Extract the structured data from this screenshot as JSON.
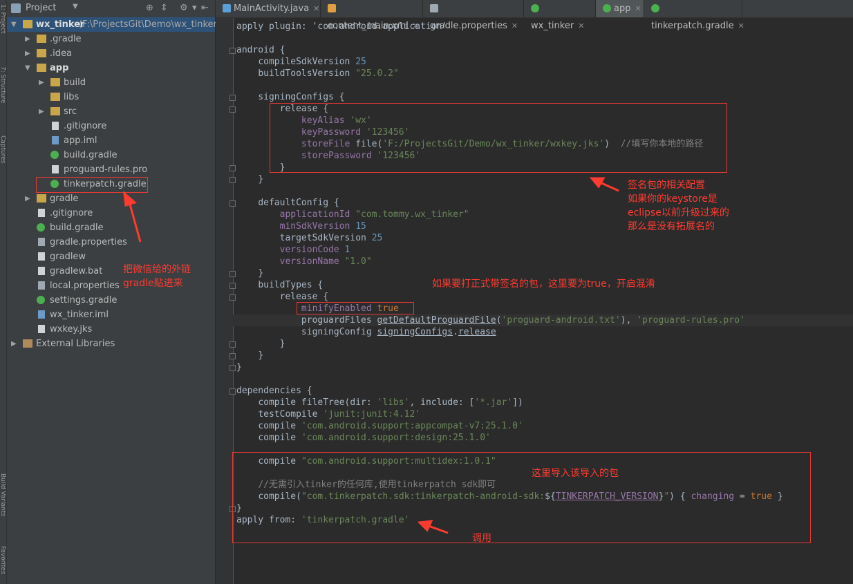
{
  "tool_strip": {
    "top_label": "1: Project",
    "mid_label": "7: Structure",
    "low_label": "Captures",
    "bottom_label": "Build Variants",
    "fav_label": "Favorites"
  },
  "project_panel": {
    "title": "Project",
    "tree": [
      {
        "label": "wx_tinker",
        "suffix": "(F:\\ProjectsGit\\Demo\\wx_tinker)",
        "depth": 0,
        "arrow": "open",
        "icon": "folder-icon"
      },
      {
        "label": ".gradle",
        "depth": 1,
        "arrow": "closed",
        "icon": "folder-icon"
      },
      {
        "label": ".idea",
        "depth": 1,
        "arrow": "closed",
        "icon": "folder-icon"
      },
      {
        "label": "app",
        "depth": 1,
        "arrow": "open",
        "icon": "folder-icon"
      },
      {
        "label": "build",
        "depth": 2,
        "arrow": "closed",
        "icon": "folder-icon"
      },
      {
        "label": "libs",
        "depth": 2,
        "arrow": "none",
        "icon": "folder-icon"
      },
      {
        "label": "src",
        "depth": 2,
        "arrow": "closed",
        "icon": "folder-icon"
      },
      {
        "label": ".gitignore",
        "depth": 2,
        "arrow": "none",
        "icon": "file-icon"
      },
      {
        "label": "app.iml",
        "depth": 2,
        "arrow": "none",
        "icon": "iml-icon"
      },
      {
        "label": "build.gradle",
        "depth": 2,
        "arrow": "none",
        "icon": "gradle-icon"
      },
      {
        "label": "proguard-rules.pro",
        "depth": 2,
        "arrow": "none",
        "icon": "file-icon"
      },
      {
        "label": "tinkerpatch.gradle",
        "depth": 2,
        "arrow": "none",
        "icon": "gradle-icon"
      },
      {
        "label": "gradle",
        "depth": 1,
        "arrow": "closed",
        "icon": "folder-icon"
      },
      {
        "label": ".gitignore",
        "depth": 1,
        "arrow": "none",
        "icon": "file-icon"
      },
      {
        "label": "build.gradle",
        "depth": 1,
        "arrow": "none",
        "icon": "gradle-icon"
      },
      {
        "label": "gradle.properties",
        "depth": 1,
        "arrow": "none",
        "icon": "properties-icon"
      },
      {
        "label": "gradlew",
        "depth": 1,
        "arrow": "none",
        "icon": "file-icon"
      },
      {
        "label": "gradlew.bat",
        "depth": 1,
        "arrow": "none",
        "icon": "file-icon"
      },
      {
        "label": "local.properties",
        "depth": 1,
        "arrow": "none",
        "icon": "properties-icon"
      },
      {
        "label": "settings.gradle",
        "depth": 1,
        "arrow": "none",
        "icon": "gradle-icon"
      },
      {
        "label": "wx_tinker.iml",
        "depth": 1,
        "arrow": "none",
        "icon": "iml-icon"
      },
      {
        "label": "wxkey.jks",
        "depth": 1,
        "arrow": "none",
        "icon": "file-icon"
      },
      {
        "label": "External Libraries",
        "depth": 0,
        "arrow": "closed",
        "icon": "library-icon"
      }
    ]
  },
  "tabs": [
    {
      "label": "MainActivity.java",
      "icon": "java-class-icon"
    },
    {
      "label": "content_main.xml",
      "icon": "xml-icon"
    },
    {
      "label": "gradle.properties",
      "icon": "properties-icon"
    },
    {
      "label": "wx_tinker",
      "icon": "gradle-icon"
    },
    {
      "label": "app",
      "icon": "gradle-icon",
      "active": true
    },
    {
      "label": "tinkerpatch.gradle",
      "icon": "gradle-icon"
    }
  ],
  "code_lines": [
    "apply plugin: 'com.android.application'",
    "android {",
    "compileSdkVersion 25",
    "buildToolsVersion \"25.0.2\"",
    "signingConfigs {",
    "release {",
    "keyAlias 'wx'",
    "keyPassword '123456'",
    "storeFile file('F:/ProjectsGit/Demo/wx_tinker/wxkey.jks')",
    "//填写你本地的路径",
    "storePassword '123456'",
    "}",
    "}",
    "defaultConfig {",
    "applicationId \"com.tommy.wx_tinker\"",
    "minSdkVersion 15",
    "targetSdkVersion 25",
    "versionCode 1",
    "versionName \"1.0\"",
    "}",
    "buildTypes {",
    "release {",
    "minifyEnabled true",
    "proguardFiles getDefaultProguardFile('proguard-android.txt'), 'proguard-rules.pro'",
    "signingConfig signingConfigs.release",
    "}",
    "}",
    "}",
    "dependencies {",
    "compile fileTree(dir: 'libs', include: ['*.jar'])",
    "testCompile 'junit:junit:4.12'",
    "compile 'com.android.support:appcompat-v7:25.1.0'",
    "compile 'com.android.support:design:25.1.0'",
    "compile \"com.android.support:multidex:1.0.1\"",
    "//无需引入tinker的任何库,使用tinkerpatch sdk即可",
    "compile(\"com.tinkerpatch.sdk:tinkerpatch-android-sdk:${TINKERPATCH_VERSION}\") { changing = true }",
    "}",
    "apply from: 'tinkerpatch.gradle'"
  ],
  "annotations": {
    "gradle_note": [
      "把微信给的外链",
      "gradle贴进来"
    ],
    "signing_note": [
      "签名包的相关配置",
      "如果你的keystore是",
      "eclipse以前升级过来的",
      "那么是没有拓展名的"
    ],
    "release_note": "如果要打正式带签名的包，这里要为true，开启混淆",
    "deps_note": "这里导入该导入的包",
    "apply_note": "调用"
  },
  "colors": {
    "annotation_red": "#ff3b30",
    "string_green": "#6a8759",
    "number_blue": "#6897bb",
    "property_purple": "#9876aa"
  }
}
